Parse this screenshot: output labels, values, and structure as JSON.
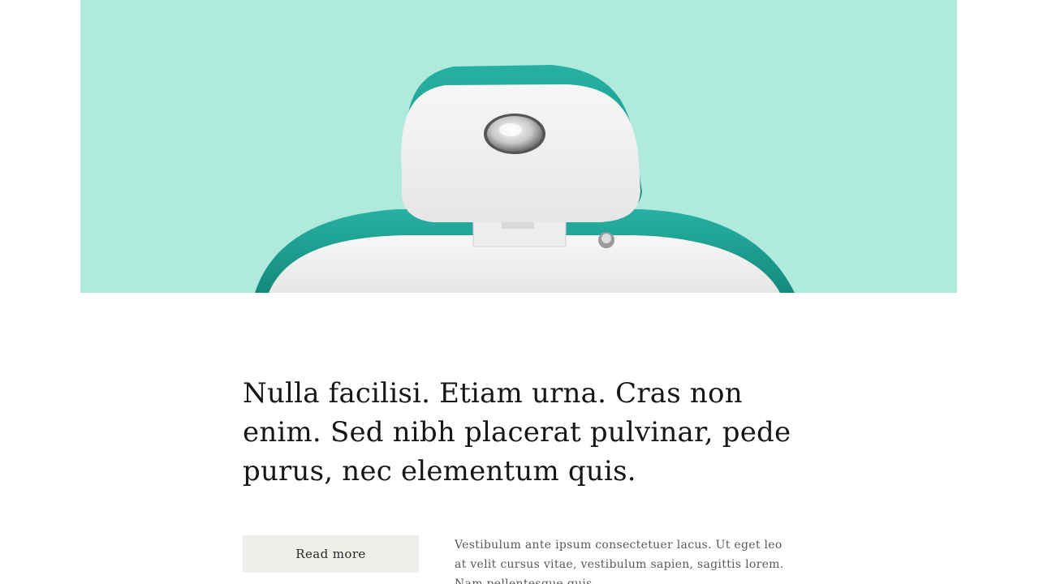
{
  "hero": {
    "image_subject": "dental-chair-headrest-photo",
    "background_color": "#b0eadd",
    "accent_color": "#1a9a8c"
  },
  "article": {
    "headline": "Nulla facilisi. Etiam urna. Cras non enim. Sed nibh placerat pulvinar, pede purus, nec elementum quis.",
    "read_more_label": "Read more",
    "excerpt": "Vestibulum ante ipsum consectetuer lacus. Ut eget leo at velit cursus vitae, vestibulum sapien, sagittis lorem. Nam pellentesque quis."
  }
}
